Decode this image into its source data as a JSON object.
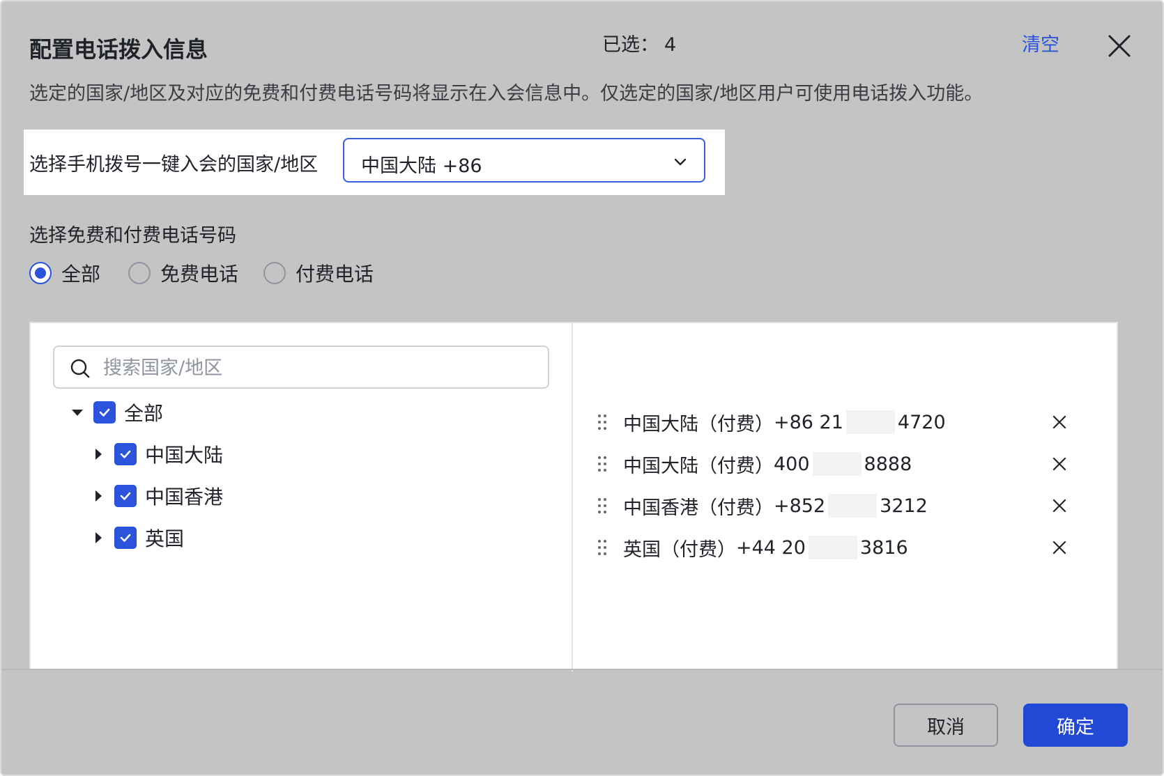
{
  "dialog": {
    "title": "配置电话拨入信息",
    "description": "选定的国家/地区及对应的免费和付费电话号码将显示在入会信息中。仅选定的国家/地区用户可使用电话拨入功能。",
    "close_icon": "close-icon"
  },
  "one_tap": {
    "label": "选择手机拨号一键入会的国家/地区",
    "selected_value": "中国大陆 +86",
    "dropdown_icon": "chevron-down-icon"
  },
  "number_type": {
    "label": "选择免费和付费电话号码",
    "options": [
      {
        "label": "全部",
        "selected": true
      },
      {
        "label": "免费电话",
        "selected": false
      },
      {
        "label": "付费电话",
        "selected": false
      }
    ]
  },
  "search": {
    "placeholder": "搜索国家/地区",
    "value": ""
  },
  "tree": {
    "root": {
      "label": "全部",
      "checked": true,
      "expanded": true
    },
    "children": [
      {
        "label": "中国大陆",
        "checked": true,
        "expanded": false
      },
      {
        "label": "中国香港",
        "checked": true,
        "expanded": false
      },
      {
        "label": "英国",
        "checked": true,
        "expanded": false
      }
    ]
  },
  "selected": {
    "count_label": "已选：",
    "count": "4",
    "clear_label": "清空",
    "items": [
      {
        "name": "中国大陆（付费）",
        "prefix": "+86 21",
        "suffix": "4720"
      },
      {
        "name": "中国大陆（付费）",
        "prefix": "400",
        "suffix": "8888"
      },
      {
        "name": "中国香港（付费）",
        "prefix": "+852",
        "suffix": "3212"
      },
      {
        "name": "英国（付费）",
        "prefix": "+44 20",
        "suffix": "3816"
      }
    ]
  },
  "footer": {
    "cancel_label": "取消",
    "confirm_label": "确定"
  },
  "colors": {
    "accent": "#2b53db",
    "overlay": "#c4c4c4",
    "confirm_button": "#2149d6"
  }
}
